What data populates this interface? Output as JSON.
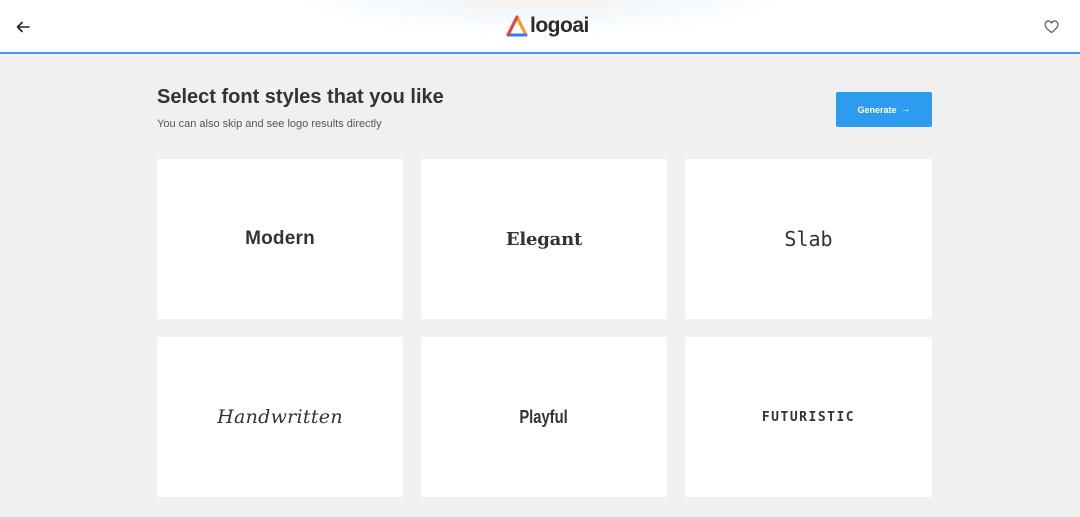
{
  "header": {
    "logo_text": "logoai",
    "back_icon": "arrow-left-icon",
    "favorite_icon": "heart-outline-icon",
    "accent_color": "#3d9df5"
  },
  "main": {
    "title": "Select font styles that you like",
    "subtitle": "You can also skip and see logo results directly",
    "generate_label": "Generate",
    "generate_arrow": "→",
    "button_color": "#2d9bf0"
  },
  "font_styles": [
    {
      "label": "Modern"
    },
    {
      "label": "Elegant"
    },
    {
      "label": "Slab"
    },
    {
      "label": "Handwritten"
    },
    {
      "label": "Playful"
    },
    {
      "label": "FUTURISTIC"
    }
  ]
}
